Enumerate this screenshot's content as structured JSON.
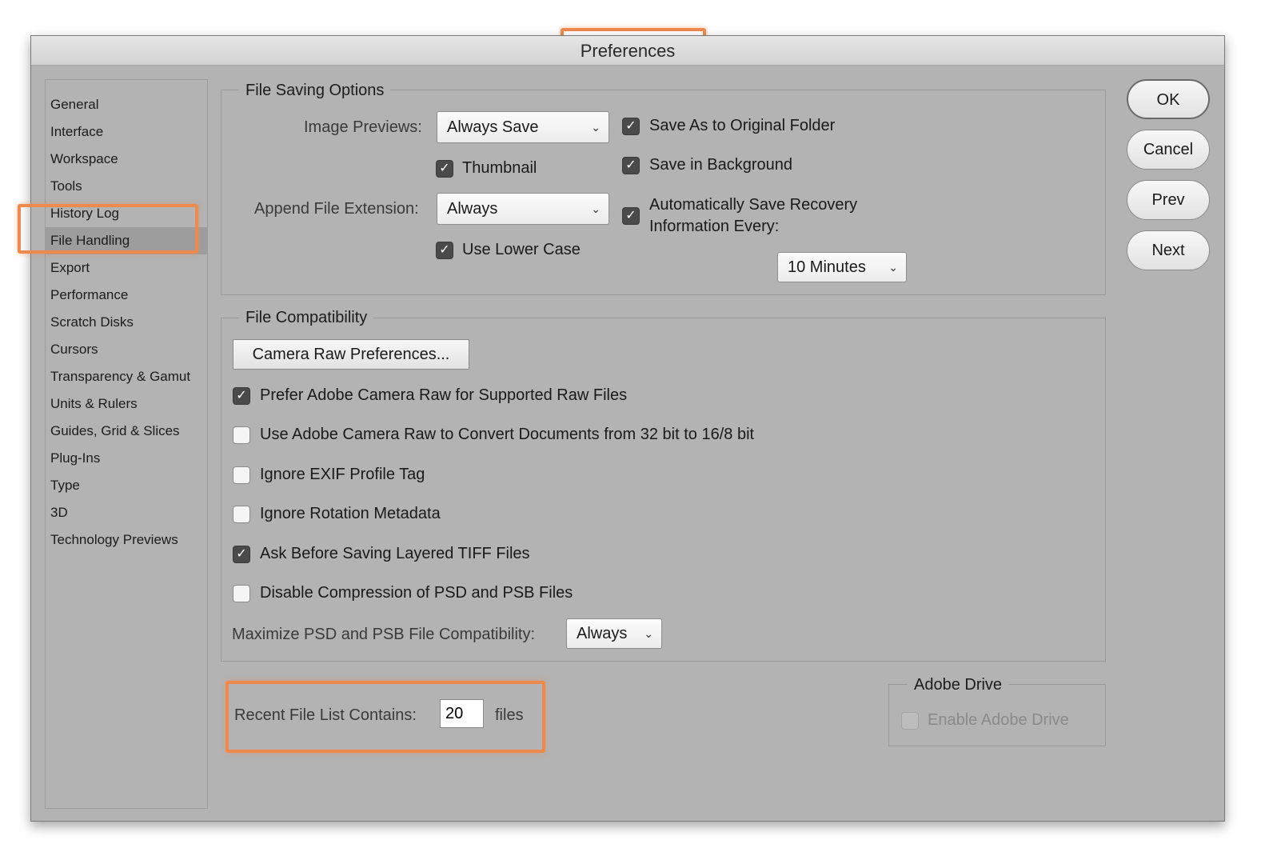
{
  "window": {
    "title": "Preferences"
  },
  "sidebar": {
    "selected_index": 5,
    "items": [
      {
        "label": "General"
      },
      {
        "label": "Interface"
      },
      {
        "label": "Workspace"
      },
      {
        "label": "Tools"
      },
      {
        "label": "History Log"
      },
      {
        "label": "File Handling"
      },
      {
        "label": "Export"
      },
      {
        "label": "Performance"
      },
      {
        "label": "Scratch Disks"
      },
      {
        "label": "Cursors"
      },
      {
        "label": "Transparency & Gamut"
      },
      {
        "label": "Units & Rulers"
      },
      {
        "label": "Guides, Grid & Slices"
      },
      {
        "label": "Plug-Ins"
      },
      {
        "label": "Type"
      },
      {
        "label": "3D"
      },
      {
        "label": "Technology Previews"
      }
    ]
  },
  "file_saving": {
    "legend": "File Saving Options",
    "image_previews_label": "Image Previews:",
    "image_previews_value": "Always Save",
    "thumbnail": {
      "label": "Thumbnail",
      "checked": true
    },
    "append_ext_label": "Append File Extension:",
    "append_ext_value": "Always",
    "lower_case": {
      "label": "Use Lower Case",
      "checked": true
    },
    "save_original": {
      "label": "Save As to Original Folder",
      "checked": true
    },
    "save_background": {
      "label": "Save in Background",
      "checked": true
    },
    "auto_recovery": {
      "label_line1": "Automatically Save Recovery",
      "label_line2": "Information Every:",
      "checked": true
    },
    "recovery_interval": "10 Minutes"
  },
  "file_compat": {
    "legend": "File Compatibility",
    "camera_raw_button": "Camera Raw Preferences...",
    "options": [
      {
        "label": "Prefer Adobe Camera Raw for Supported Raw Files",
        "checked": true
      },
      {
        "label": "Use Adobe Camera Raw to Convert Documents from 32 bit to 16/8 bit",
        "checked": false
      },
      {
        "label": "Ignore EXIF Profile Tag",
        "checked": false
      },
      {
        "label": "Ignore Rotation Metadata",
        "checked": false
      },
      {
        "label": "Ask Before Saving Layered TIFF Files",
        "checked": true
      },
      {
        "label": "Disable Compression of PSD and PSB Files",
        "checked": false
      }
    ],
    "maximize_label": "Maximize PSD and PSB File Compatibility:",
    "maximize_value": "Always"
  },
  "recent_files": {
    "label": "Recent File List Contains:",
    "value": "20",
    "unit": "files"
  },
  "adobe_drive": {
    "legend": "Adobe Drive",
    "enable_label": "Enable Adobe Drive",
    "checked": false,
    "disabled": true
  },
  "buttons": {
    "ok": "OK",
    "cancel": "Cancel",
    "prev": "Prev",
    "next": "Next"
  },
  "colors": {
    "highlight": "#ef8a4f",
    "dialog_bg": "#b3b3b3",
    "selected_item": "#9d9d9d"
  }
}
